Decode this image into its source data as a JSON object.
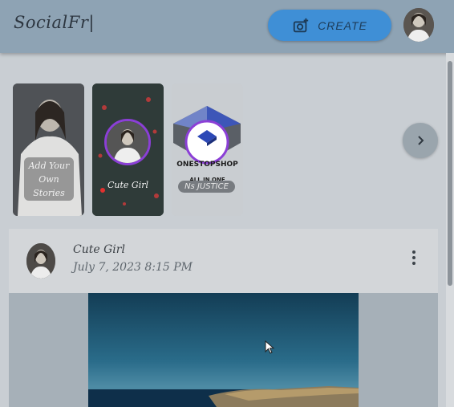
{
  "header": {
    "logo": "SocialFr|",
    "create_label": "CREATE"
  },
  "stories": [
    {
      "label": "Add Your Own Stories"
    },
    {
      "name": "Cute Girl"
    },
    {
      "title": "ONESTOPSHOP",
      "subtitle": "ALL IN ONE",
      "badge": "Ns JUSTICE"
    }
  ],
  "post": {
    "author": "Cute Girl",
    "date": "July 7, 2023 8:15 PM"
  },
  "colors": {
    "header_bg": "#8ea3b4",
    "create_button": "#3f8fd6",
    "story_ring": "#8b3fd6"
  },
  "icons": [
    "camera-add-icon",
    "chevron-right-icon",
    "more-vert-icon",
    "cursor-icon"
  ]
}
